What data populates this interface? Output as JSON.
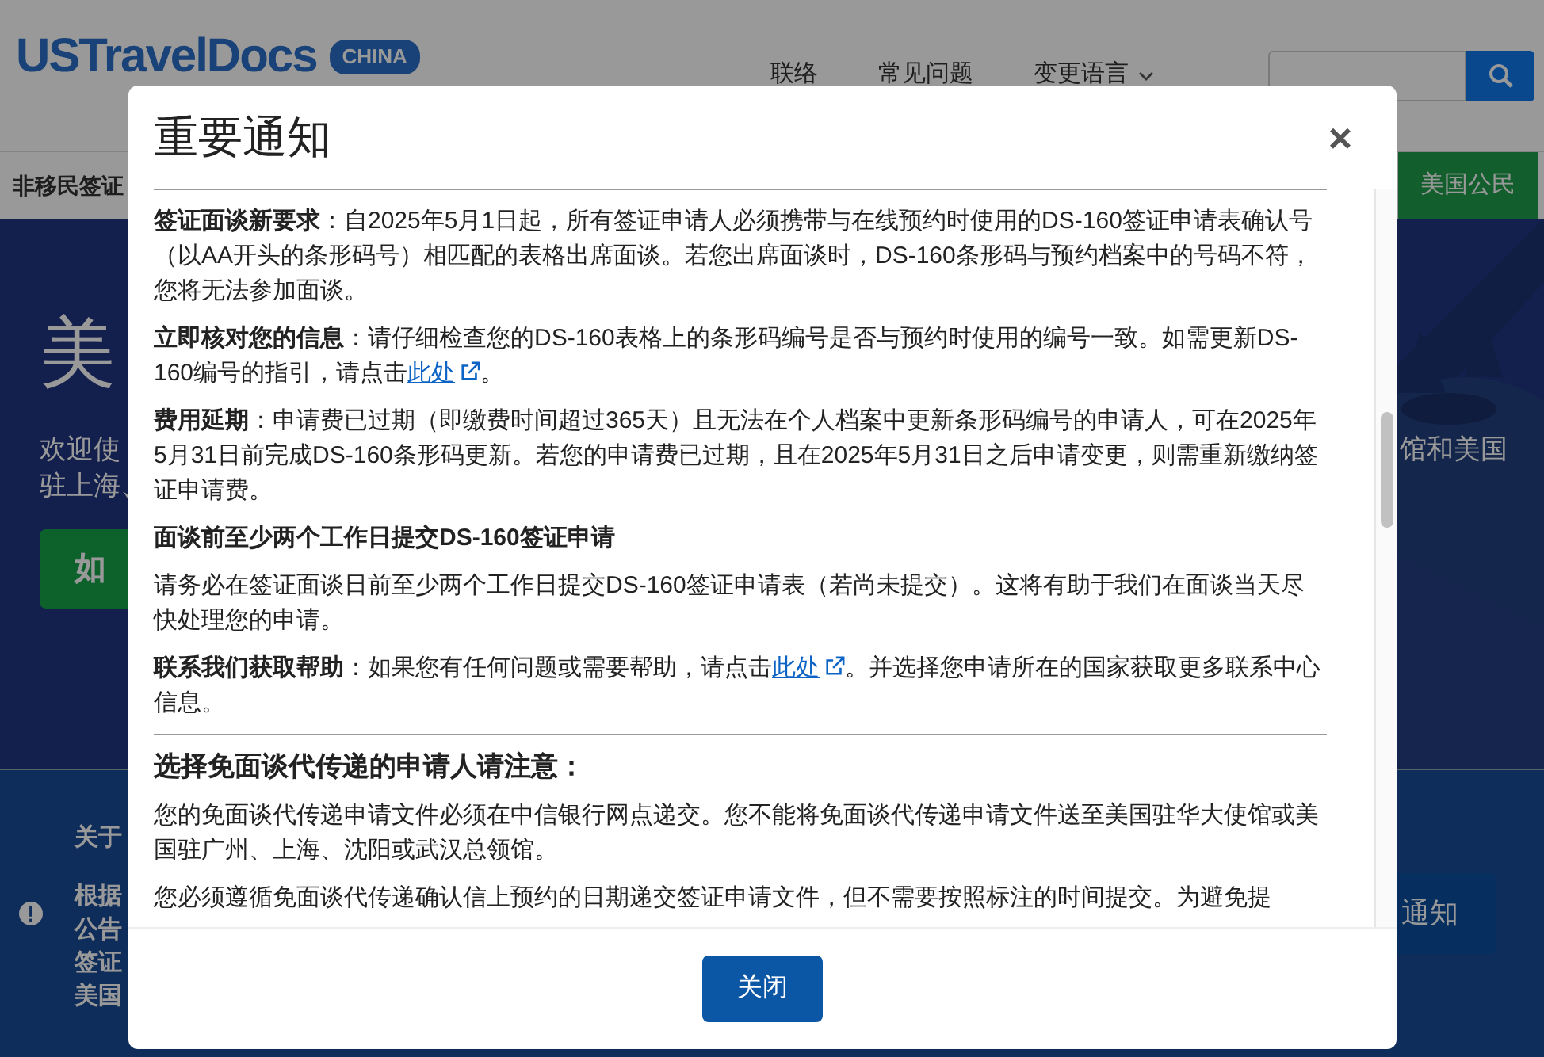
{
  "header": {
    "logo": "USTravelDocs",
    "logo_badge": "CHINA",
    "nav": [
      "联络",
      "常见问题",
      "变更语言"
    ]
  },
  "subnav": {
    "left": "非移民签证",
    "right": "美国公民"
  },
  "hero": {
    "title": "美",
    "intro_left": [
      "欢迎使",
      "驻上海、"
    ],
    "intro_right": "馆和美国",
    "button": "如"
  },
  "alert": {
    "heading": "关于",
    "lines": [
      "根据",
      "公告",
      "签证",
      "美国"
    ],
    "button": "通知"
  },
  "modal": {
    "title": "重要通知",
    "close": "×",
    "content": [
      {
        "kind": "para",
        "text": "**签证面谈新要求**：自2025年5月1日起，所有签证申请人必须携带与在线预约时使用的DS-160签证申请表确认号（以AA开头的条形码号）相匹配的表格出席面谈。若您出席面谈时，DS-160条形码与预约档案中的号码不符，您将无法参加面谈。"
      },
      {
        "kind": "para",
        "text": "**立即核对您的信息**：请仔细检查您的DS-160表格上的条形码编号是否与预约时使用的编号一致。如需更新DS-160编号的指引，请点击",
        "link": "此处",
        "after": "。"
      },
      {
        "kind": "para",
        "text": "**费用延期**：申请费已过期（即缴费时间超过365天）且无法在个人档案中更新条形码编号的申请人，可在2025年5月31日前完成DS-160条形码更新。若您的申请费已过期，且在2025年5月31日之后申请变更，则需重新缴纳签证申请费。"
      },
      {
        "kind": "subheading",
        "text": "面谈前至少两个工作日提交DS-160签证申请"
      },
      {
        "kind": "para",
        "text": "请务必在签证面谈日前至少两个工作日提交DS-160签证申请表（若尚未提交）。这将有助于我们在面谈当天尽快处理您的申请。"
      },
      {
        "kind": "para",
        "text": "**联系我们获取帮助**：如果您有任何问题或需要帮助，请点击",
        "link": "此处",
        "after": "。并选择您申请所在的国家获取更多联系中心信息。"
      },
      {
        "kind": "divider"
      },
      {
        "kind": "heading",
        "text": "选择免面谈代传递的申请人请注意："
      },
      {
        "kind": "para",
        "text": "您的免面谈代传递申请文件必须在中信银行网点递交。您不能将免面谈代传递申请文件送至美国驻华大使馆或美国驻广州、上海、沈阳或武汉总领馆。"
      },
      {
        "kind": "para",
        "text": "您必须遵循免面谈代传递确认信上预约的日期递交签证申请文件，但不需要按照标注的时间提交。为避免提"
      }
    ],
    "footer_button": "关闭"
  }
}
